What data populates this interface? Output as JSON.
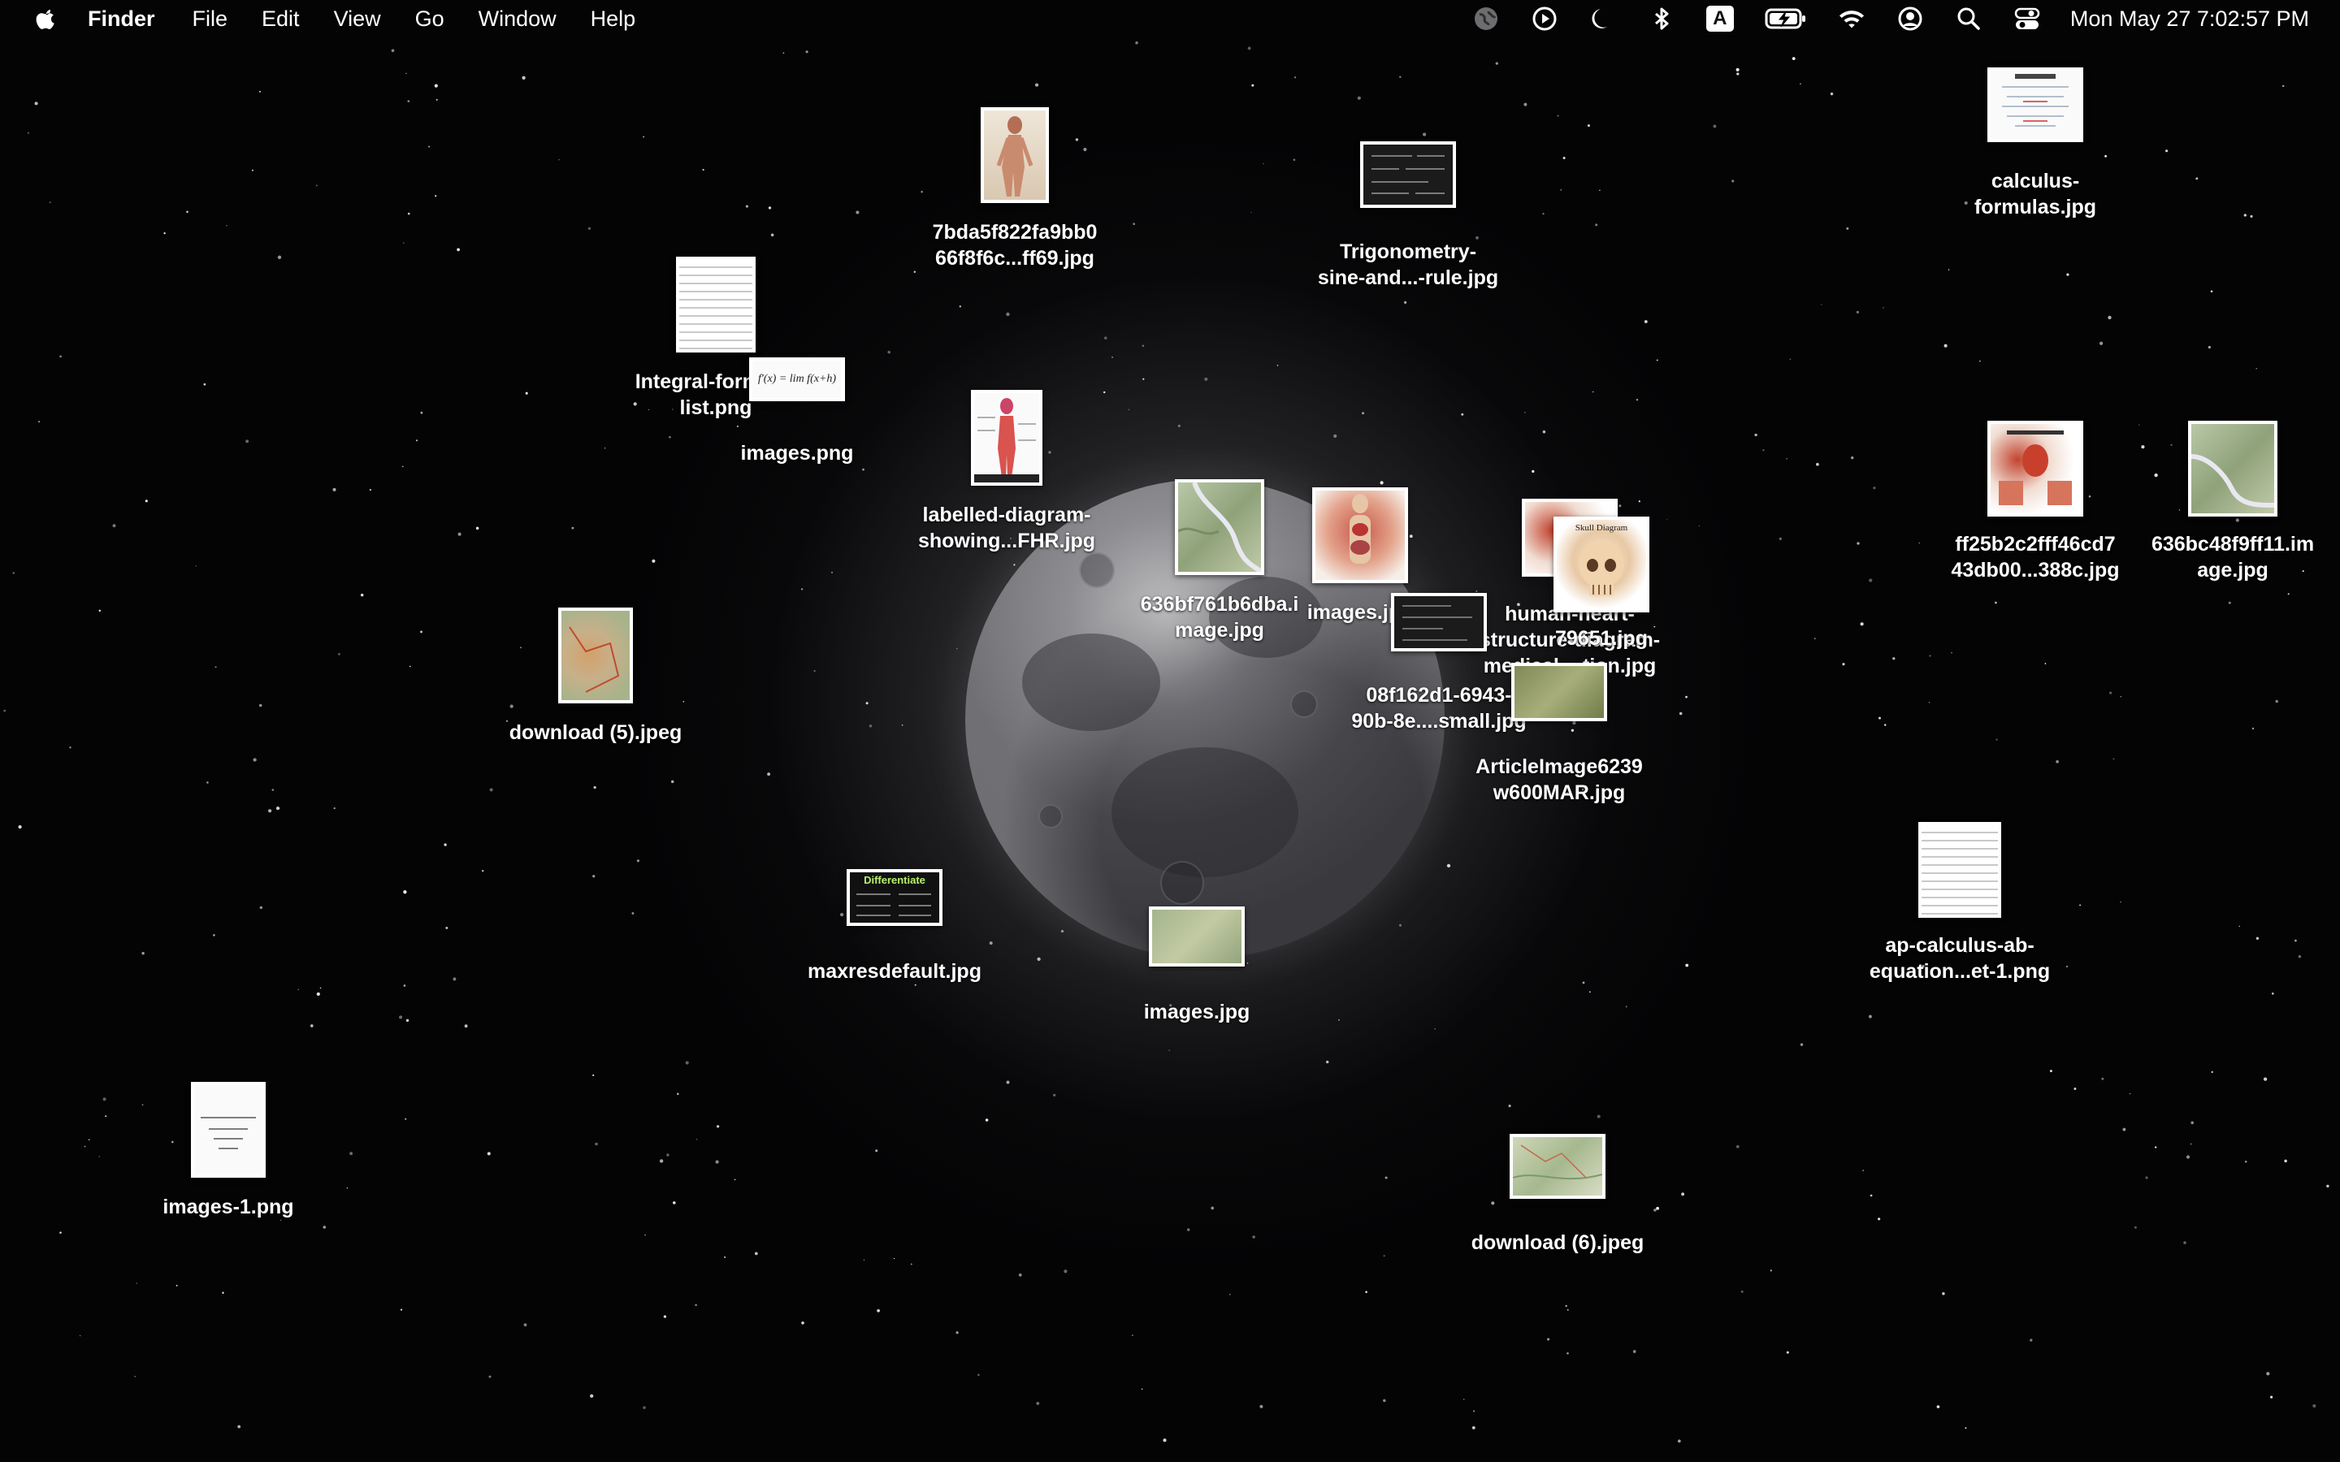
{
  "menubar": {
    "apple_icon": "apple-icon",
    "app_name": "Finder",
    "menus": [
      "File",
      "Edit",
      "View",
      "Go",
      "Window",
      "Help"
    ],
    "status_icons": [
      "globe-icon",
      "play-circle-icon",
      "moon-icon",
      "bluetooth-icon",
      "input-source-icon",
      "battery-charging-icon",
      "wifi-icon",
      "user-icon",
      "search-icon",
      "control-center-icon"
    ],
    "input_source_label": "A",
    "clock": "Mon May 27  7:02:57 PM"
  },
  "desktop": {
    "wallpaper": "moon-in-starfield",
    "icons": [
      {
        "label": "7bda5f822fa9bb0\n66f8f6c...ff69.jpg",
        "kind": "anatomy"
      },
      {
        "label": "Trigonometry-\nsine-and...-rule.jpg",
        "kind": "dark-doc"
      },
      {
        "label": "calculus-\nformulas.jpg",
        "kind": "white-doc"
      },
      {
        "label": "Integral-formula-\nlist.png",
        "kind": "paper-doc"
      },
      {
        "label": "images.png",
        "kind": "formula",
        "formula_text": "f'(x) = lim f(x+h)−f(x) / h"
      },
      {
        "label": "labelled-diagram-\nshowing...FHR.jpg",
        "kind": "anatomy-chart"
      },
      {
        "label": "636bf761b6dba.i\nmage.jpg",
        "kind": "map"
      },
      {
        "label": "images.jpg",
        "kind": "organs"
      },
      {
        "label": "human-heart-\nstructure-diagram-\nmedical-...tion.jpg",
        "kind": "chart"
      },
      {
        "label": "79651.jpg",
        "kind": "skull",
        "inner_caption": "Skull Diagram"
      },
      {
        "label": "08f162d1-6943-\n90b-8e....small.jpg",
        "kind": "dark-doc"
      },
      {
        "label": "ArticleImage6239\nw600MAR.jpg",
        "kind": "map"
      },
      {
        "label": "ff25b2c2fff46cd7\n43db00...388c.jpg",
        "kind": "chart"
      },
      {
        "label": "636bc48f9ff11.im\nage.jpg",
        "kind": "map"
      },
      {
        "label": "download (5).jpeg",
        "kind": "map"
      },
      {
        "label": "maxresdefault.jpg",
        "kind": "dark-doc",
        "inner_caption": "Differentiate"
      },
      {
        "label": "images.jpg",
        "kind": "map"
      },
      {
        "label": "ap-calculus-ab-\nequation...et-1.png",
        "kind": "paper-doc"
      },
      {
        "label": "images-1.png",
        "kind": "white-doc"
      },
      {
        "label": "download (6).jpeg",
        "kind": "map"
      }
    ]
  }
}
